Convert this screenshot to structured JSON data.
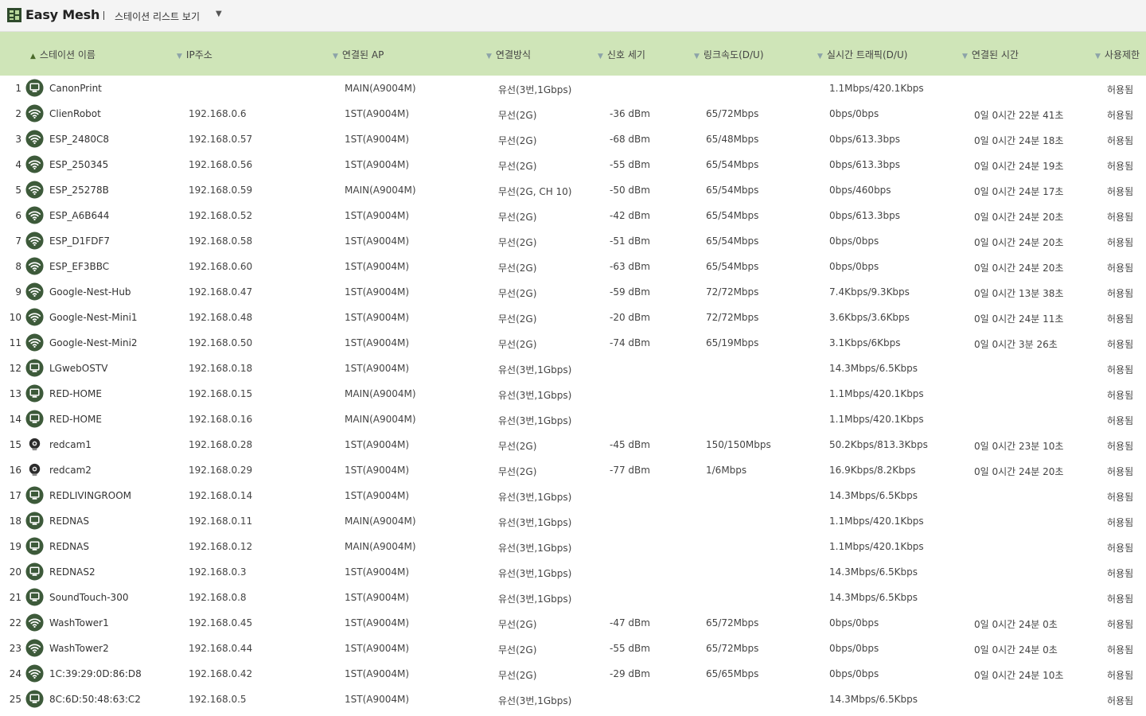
{
  "app": {
    "title": "Easy Mesh",
    "view_label": "스테이션 리스트 보기",
    "view_arrow": "▼"
  },
  "columns": [
    {
      "key": "name",
      "label": "스테이션 이름",
      "sort": "asc"
    },
    {
      "key": "ip",
      "label": "IP주소",
      "sort": "none"
    },
    {
      "key": "ap",
      "label": "연결된 AP",
      "sort": "none"
    },
    {
      "key": "conn",
      "label": "연결방식",
      "sort": "none"
    },
    {
      "key": "signal",
      "label": "신호 세기",
      "sort": "none"
    },
    {
      "key": "link",
      "label": "링크속도(D/U)",
      "sort": "none"
    },
    {
      "key": "traffic",
      "label": "실시간 트래픽(D/U)",
      "sort": "none"
    },
    {
      "key": "time",
      "label": "연결된 시간",
      "sort": "none"
    },
    {
      "key": "access",
      "label": "사용제한",
      "sort": "none"
    }
  ],
  "stations": [
    {
      "num": "1",
      "icon": "wired",
      "name": "CanonPrint",
      "ip": "",
      "ap": "MAIN(A9004M)",
      "conn": "유선(3번,1Gbps)",
      "signal": "",
      "link": "",
      "traffic": "1.1Mbps/420.1Kbps",
      "time": "",
      "access": "허용됨"
    },
    {
      "num": "2",
      "icon": "wifi",
      "name": "ClienRobot",
      "ip": "192.168.0.6",
      "ap": "1ST(A9004M)",
      "conn": "무선(2G)",
      "signal": "-36 dBm",
      "link": "65/72Mbps",
      "traffic": "0bps/0bps",
      "time": "0일 0시간 22분 41초",
      "access": "허용됨"
    },
    {
      "num": "3",
      "icon": "wifi",
      "name": "ESP_2480C8",
      "ip": "192.168.0.57",
      "ap": "1ST(A9004M)",
      "conn": "무선(2G)",
      "signal": "-68 dBm",
      "link": "65/48Mbps",
      "traffic": "0bps/613.3bps",
      "time": "0일 0시간 24분 18초",
      "access": "허용됨"
    },
    {
      "num": "4",
      "icon": "wifi",
      "name": "ESP_250345",
      "ip": "192.168.0.56",
      "ap": "1ST(A9004M)",
      "conn": "무선(2G)",
      "signal": "-55 dBm",
      "link": "65/54Mbps",
      "traffic": "0bps/613.3bps",
      "time": "0일 0시간 24분 19초",
      "access": "허용됨"
    },
    {
      "num": "5",
      "icon": "wifi",
      "name": "ESP_25278B",
      "ip": "192.168.0.59",
      "ap": "MAIN(A9004M)",
      "conn": "무선(2G, CH 10)",
      "signal": "-50 dBm",
      "link": "65/54Mbps",
      "traffic": "0bps/460bps",
      "time": "0일 0시간 24분 17초",
      "access": "허용됨"
    },
    {
      "num": "6",
      "icon": "wifi",
      "name": "ESP_A6B644",
      "ip": "192.168.0.52",
      "ap": "1ST(A9004M)",
      "conn": "무선(2G)",
      "signal": "-42 dBm",
      "link": "65/54Mbps",
      "traffic": "0bps/613.3bps",
      "time": "0일 0시간 24분 20초",
      "access": "허용됨"
    },
    {
      "num": "7",
      "icon": "wifi",
      "name": "ESP_D1FDF7",
      "ip": "192.168.0.58",
      "ap": "1ST(A9004M)",
      "conn": "무선(2G)",
      "signal": "-51 dBm",
      "link": "65/54Mbps",
      "traffic": "0bps/0bps",
      "time": "0일 0시간 24분 20초",
      "access": "허용됨"
    },
    {
      "num": "8",
      "icon": "wifi",
      "name": "ESP_EF3BBC",
      "ip": "192.168.0.60",
      "ap": "1ST(A9004M)",
      "conn": "무선(2G)",
      "signal": "-63 dBm",
      "link": "65/54Mbps",
      "traffic": "0bps/0bps",
      "time": "0일 0시간 24분 20초",
      "access": "허용됨"
    },
    {
      "num": "9",
      "icon": "wifi",
      "name": "Google-Nest-Hub",
      "ip": "192.168.0.47",
      "ap": "1ST(A9004M)",
      "conn": "무선(2G)",
      "signal": "-59 dBm",
      "link": "72/72Mbps",
      "traffic": "7.4Kbps/9.3Kbps",
      "time": "0일 0시간 13분 38초",
      "access": "허용됨"
    },
    {
      "num": "10",
      "icon": "wifi",
      "name": "Google-Nest-Mini1",
      "ip": "192.168.0.48",
      "ap": "1ST(A9004M)",
      "conn": "무선(2G)",
      "signal": "-20 dBm",
      "link": "72/72Mbps",
      "traffic": "3.6Kbps/3.6Kbps",
      "time": "0일 0시간 24분 11초",
      "access": "허용됨"
    },
    {
      "num": "11",
      "icon": "wifi",
      "name": "Google-Nest-Mini2",
      "ip": "192.168.0.50",
      "ap": "1ST(A9004M)",
      "conn": "무선(2G)",
      "signal": "-74 dBm",
      "link": "65/19Mbps",
      "traffic": "3.1Kbps/6Kbps",
      "time": "0일 0시간 3분 26초",
      "access": "허용됨"
    },
    {
      "num": "12",
      "icon": "wired",
      "name": "LGwebOSTV",
      "ip": "192.168.0.18",
      "ap": "1ST(A9004M)",
      "conn": "유선(3번,1Gbps)",
      "signal": "",
      "link": "",
      "traffic": "14.3Mbps/6.5Kbps",
      "time": "",
      "access": "허용됨"
    },
    {
      "num": "13",
      "icon": "wired",
      "name": "RED-HOME",
      "ip": "192.168.0.15",
      "ap": "MAIN(A9004M)",
      "conn": "유선(3번,1Gbps)",
      "signal": "",
      "link": "",
      "traffic": "1.1Mbps/420.1Kbps",
      "time": "",
      "access": "허용됨"
    },
    {
      "num": "14",
      "icon": "wired",
      "name": "RED-HOME",
      "ip": "192.168.0.16",
      "ap": "MAIN(A9004M)",
      "conn": "유선(3번,1Gbps)",
      "signal": "",
      "link": "",
      "traffic": "1.1Mbps/420.1Kbps",
      "time": "",
      "access": "허용됨"
    },
    {
      "num": "15",
      "icon": "camera",
      "name": "redcam1",
      "ip": "192.168.0.28",
      "ap": "1ST(A9004M)",
      "conn": "무선(2G)",
      "signal": "-45 dBm",
      "link": "150/150Mbps",
      "traffic": "50.2Kbps/813.3Kbps",
      "time": "0일 0시간 23분 10초",
      "access": "허용됨"
    },
    {
      "num": "16",
      "icon": "camera",
      "name": "redcam2",
      "ip": "192.168.0.29",
      "ap": "1ST(A9004M)",
      "conn": "무선(2G)",
      "signal": "-77 dBm",
      "link": "1/6Mbps",
      "traffic": "16.9Kbps/8.2Kbps",
      "time": "0일 0시간 24분 20초",
      "access": "허용됨"
    },
    {
      "num": "17",
      "icon": "wired",
      "name": "REDLIVINGROOM",
      "ip": "192.168.0.14",
      "ap": "1ST(A9004M)",
      "conn": "유선(3번,1Gbps)",
      "signal": "",
      "link": "",
      "traffic": "14.3Mbps/6.5Kbps",
      "time": "",
      "access": "허용됨"
    },
    {
      "num": "18",
      "icon": "wired",
      "name": "REDNAS",
      "ip": "192.168.0.11",
      "ap": "MAIN(A9004M)",
      "conn": "유선(3번,1Gbps)",
      "signal": "",
      "link": "",
      "traffic": "1.1Mbps/420.1Kbps",
      "time": "",
      "access": "허용됨"
    },
    {
      "num": "19",
      "icon": "wired",
      "name": "REDNAS",
      "ip": "192.168.0.12",
      "ap": "MAIN(A9004M)",
      "conn": "유선(3번,1Gbps)",
      "signal": "",
      "link": "",
      "traffic": "1.1Mbps/420.1Kbps",
      "time": "",
      "access": "허용됨"
    },
    {
      "num": "20",
      "icon": "wired",
      "name": "REDNAS2",
      "ip": "192.168.0.3",
      "ap": "1ST(A9004M)",
      "conn": "유선(3번,1Gbps)",
      "signal": "",
      "link": "",
      "traffic": "14.3Mbps/6.5Kbps",
      "time": "",
      "access": "허용됨"
    },
    {
      "num": "21",
      "icon": "wired",
      "name": "SoundTouch-300",
      "ip": "192.168.0.8",
      "ap": "1ST(A9004M)",
      "conn": "유선(3번,1Gbps)",
      "signal": "",
      "link": "",
      "traffic": "14.3Mbps/6.5Kbps",
      "time": "",
      "access": "허용됨"
    },
    {
      "num": "22",
      "icon": "wifi",
      "name": "WashTower1",
      "ip": "192.168.0.45",
      "ap": "1ST(A9004M)",
      "conn": "무선(2G)",
      "signal": "-47 dBm",
      "link": "65/72Mbps",
      "traffic": "0bps/0bps",
      "time": "0일 0시간 24분 0초",
      "access": "허용됨"
    },
    {
      "num": "23",
      "icon": "wifi",
      "name": "WashTower2",
      "ip": "192.168.0.44",
      "ap": "1ST(A9004M)",
      "conn": "무선(2G)",
      "signal": "-55 dBm",
      "link": "65/72Mbps",
      "traffic": "0bps/0bps",
      "time": "0일 0시간 24분 0초",
      "access": "허용됨"
    },
    {
      "num": "24",
      "icon": "wifi",
      "name": "1C:39:29:0D:86:D8",
      "ip": "192.168.0.42",
      "ap": "1ST(A9004M)",
      "conn": "무선(2G)",
      "signal": "-29 dBm",
      "link": "65/65Mbps",
      "traffic": "0bps/0bps",
      "time": "0일 0시간 24분 10초",
      "access": "허용됨"
    },
    {
      "num": "25",
      "icon": "wired",
      "name": "8C:6D:50:48:63:C2",
      "ip": "192.168.0.5",
      "ap": "1ST(A9004M)",
      "conn": "유선(3번,1Gbps)",
      "signal": "",
      "link": "",
      "traffic": "14.3Mbps/6.5Kbps",
      "time": "",
      "access": "허용됨"
    }
  ],
  "colors": {
    "header_bg": "#cfe5b8",
    "icon_green": "#3d5a3a",
    "topbar_bg": "#f4f4f4"
  }
}
